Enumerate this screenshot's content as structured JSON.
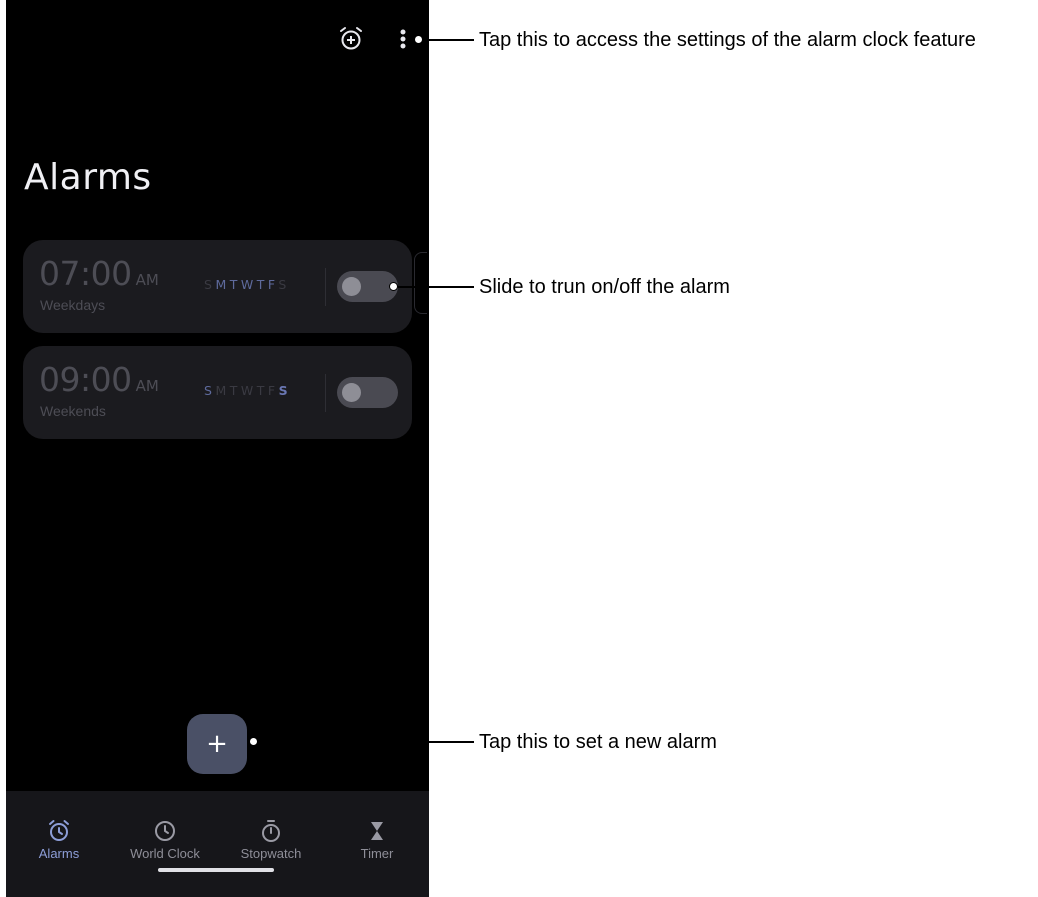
{
  "screen": {
    "title": "Alarms"
  },
  "topbar": {
    "icons": [
      "alarm-add-icon",
      "more-vertical-icon"
    ]
  },
  "alarms": [
    {
      "time": "07:00",
      "ampm": "AM",
      "label": "Weekdays",
      "days": [
        "S",
        "M",
        "T",
        "W",
        "T",
        "F",
        "S"
      ],
      "enabled": false
    },
    {
      "time": "09:00",
      "ampm": "AM",
      "label": "Weekends",
      "days": [
        "S",
        "M",
        "T",
        "W",
        "T",
        "F",
        "S"
      ],
      "enabled": false
    }
  ],
  "fab": {
    "label": "+"
  },
  "nav": {
    "items": [
      {
        "label": "Alarms",
        "icon": "alarm-icon",
        "active": true
      },
      {
        "label": "World Clock",
        "icon": "clock-icon",
        "active": false
      },
      {
        "label": "Stopwatch",
        "icon": "stopwatch-icon",
        "active": false
      },
      {
        "label": "Timer",
        "icon": "hourglass-icon",
        "active": false
      }
    ]
  },
  "callouts": {
    "settings": "Tap this to access the settings of the alarm clock feature",
    "toggle": "Slide to trun on/off the alarm",
    "add": "Tap this to set a new alarm"
  },
  "colors": {
    "accent": "#8d9ed8",
    "card": "#1b1b1f",
    "background": "#000000",
    "fab": "#4a5066"
  }
}
